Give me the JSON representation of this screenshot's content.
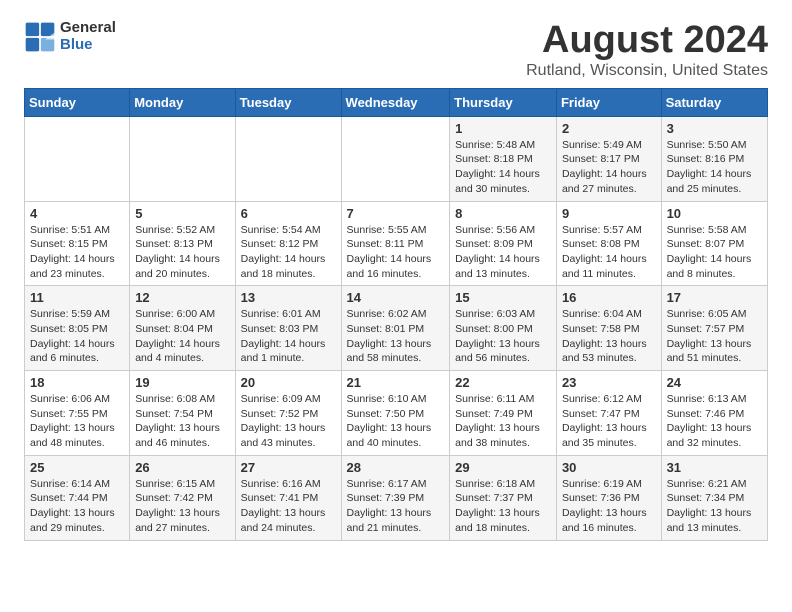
{
  "logo": {
    "line1": "General",
    "line2": "Blue"
  },
  "title": "August 2024",
  "subtitle": "Rutland, Wisconsin, United States",
  "days_of_week": [
    "Sunday",
    "Monday",
    "Tuesday",
    "Wednesday",
    "Thursday",
    "Friday",
    "Saturday"
  ],
  "weeks": [
    [
      {
        "day": "",
        "info": ""
      },
      {
        "day": "",
        "info": ""
      },
      {
        "day": "",
        "info": ""
      },
      {
        "day": "",
        "info": ""
      },
      {
        "day": "1",
        "info": "Sunrise: 5:48 AM\nSunset: 8:18 PM\nDaylight: 14 hours\nand 30 minutes."
      },
      {
        "day": "2",
        "info": "Sunrise: 5:49 AM\nSunset: 8:17 PM\nDaylight: 14 hours\nand 27 minutes."
      },
      {
        "day": "3",
        "info": "Sunrise: 5:50 AM\nSunset: 8:16 PM\nDaylight: 14 hours\nand 25 minutes."
      }
    ],
    [
      {
        "day": "4",
        "info": "Sunrise: 5:51 AM\nSunset: 8:15 PM\nDaylight: 14 hours\nand 23 minutes."
      },
      {
        "day": "5",
        "info": "Sunrise: 5:52 AM\nSunset: 8:13 PM\nDaylight: 14 hours\nand 20 minutes."
      },
      {
        "day": "6",
        "info": "Sunrise: 5:54 AM\nSunset: 8:12 PM\nDaylight: 14 hours\nand 18 minutes."
      },
      {
        "day": "7",
        "info": "Sunrise: 5:55 AM\nSunset: 8:11 PM\nDaylight: 14 hours\nand 16 minutes."
      },
      {
        "day": "8",
        "info": "Sunrise: 5:56 AM\nSunset: 8:09 PM\nDaylight: 14 hours\nand 13 minutes."
      },
      {
        "day": "9",
        "info": "Sunrise: 5:57 AM\nSunset: 8:08 PM\nDaylight: 14 hours\nand 11 minutes."
      },
      {
        "day": "10",
        "info": "Sunrise: 5:58 AM\nSunset: 8:07 PM\nDaylight: 14 hours\nand 8 minutes."
      }
    ],
    [
      {
        "day": "11",
        "info": "Sunrise: 5:59 AM\nSunset: 8:05 PM\nDaylight: 14 hours\nand 6 minutes."
      },
      {
        "day": "12",
        "info": "Sunrise: 6:00 AM\nSunset: 8:04 PM\nDaylight: 14 hours\nand 4 minutes."
      },
      {
        "day": "13",
        "info": "Sunrise: 6:01 AM\nSunset: 8:03 PM\nDaylight: 14 hours\nand 1 minute."
      },
      {
        "day": "14",
        "info": "Sunrise: 6:02 AM\nSunset: 8:01 PM\nDaylight: 13 hours\nand 58 minutes."
      },
      {
        "day": "15",
        "info": "Sunrise: 6:03 AM\nSunset: 8:00 PM\nDaylight: 13 hours\nand 56 minutes."
      },
      {
        "day": "16",
        "info": "Sunrise: 6:04 AM\nSunset: 7:58 PM\nDaylight: 13 hours\nand 53 minutes."
      },
      {
        "day": "17",
        "info": "Sunrise: 6:05 AM\nSunset: 7:57 PM\nDaylight: 13 hours\nand 51 minutes."
      }
    ],
    [
      {
        "day": "18",
        "info": "Sunrise: 6:06 AM\nSunset: 7:55 PM\nDaylight: 13 hours\nand 48 minutes."
      },
      {
        "day": "19",
        "info": "Sunrise: 6:08 AM\nSunset: 7:54 PM\nDaylight: 13 hours\nand 46 minutes."
      },
      {
        "day": "20",
        "info": "Sunrise: 6:09 AM\nSunset: 7:52 PM\nDaylight: 13 hours\nand 43 minutes."
      },
      {
        "day": "21",
        "info": "Sunrise: 6:10 AM\nSunset: 7:50 PM\nDaylight: 13 hours\nand 40 minutes."
      },
      {
        "day": "22",
        "info": "Sunrise: 6:11 AM\nSunset: 7:49 PM\nDaylight: 13 hours\nand 38 minutes."
      },
      {
        "day": "23",
        "info": "Sunrise: 6:12 AM\nSunset: 7:47 PM\nDaylight: 13 hours\nand 35 minutes."
      },
      {
        "day": "24",
        "info": "Sunrise: 6:13 AM\nSunset: 7:46 PM\nDaylight: 13 hours\nand 32 minutes."
      }
    ],
    [
      {
        "day": "25",
        "info": "Sunrise: 6:14 AM\nSunset: 7:44 PM\nDaylight: 13 hours\nand 29 minutes."
      },
      {
        "day": "26",
        "info": "Sunrise: 6:15 AM\nSunset: 7:42 PM\nDaylight: 13 hours\nand 27 minutes."
      },
      {
        "day": "27",
        "info": "Sunrise: 6:16 AM\nSunset: 7:41 PM\nDaylight: 13 hours\nand 24 minutes."
      },
      {
        "day": "28",
        "info": "Sunrise: 6:17 AM\nSunset: 7:39 PM\nDaylight: 13 hours\nand 21 minutes."
      },
      {
        "day": "29",
        "info": "Sunrise: 6:18 AM\nSunset: 7:37 PM\nDaylight: 13 hours\nand 18 minutes."
      },
      {
        "day": "30",
        "info": "Sunrise: 6:19 AM\nSunset: 7:36 PM\nDaylight: 13 hours\nand 16 minutes."
      },
      {
        "day": "31",
        "info": "Sunrise: 6:21 AM\nSunset: 7:34 PM\nDaylight: 13 hours\nand 13 minutes."
      }
    ]
  ]
}
